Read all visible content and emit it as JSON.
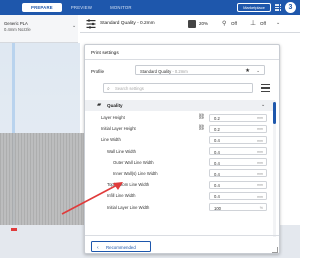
{
  "topbar": {
    "tabs": [
      {
        "label": "PREPARE",
        "active": true
      },
      {
        "label": "PREVIEW",
        "active": false
      },
      {
        "label": "MONITOR",
        "active": false
      }
    ],
    "marketplace_label": "Marketplace",
    "avatar_label": "3",
    "accent": "#1e57ac"
  },
  "material": {
    "name": "Generic PLA",
    "nozzle": "0.4mm Nozzle"
  },
  "settings_bar": {
    "quality": "Standard Quality - 0.2mm",
    "infill": "20%",
    "support": "Off",
    "adhesion": "Off"
  },
  "dialog": {
    "title": "Print settings",
    "profile_label": "Profile",
    "profile_value": "Standard Quality",
    "profile_suffix": " - 0.2mm",
    "search_placeholder": "Search settings",
    "section_label": "Quality",
    "recommended_label": "Recommended",
    "rows": [
      {
        "label": "Layer Height",
        "indent": 0,
        "linked": true,
        "value": "0.2",
        "unit": "mm"
      },
      {
        "label": "Initial Layer Height",
        "indent": 0,
        "linked": true,
        "value": "0.2",
        "unit": "mm"
      },
      {
        "label": "Line Width",
        "indent": 0,
        "linked": false,
        "value": "0.4",
        "unit": "mm"
      },
      {
        "label": "Wall Line Width",
        "indent": 1,
        "linked": false,
        "value": "0.4",
        "unit": "mm"
      },
      {
        "label": "Outer Wall Line Width",
        "indent": 2,
        "linked": false,
        "value": "0.4",
        "unit": "mm"
      },
      {
        "label": "Inner Wall(s) Line Width",
        "indent": 2,
        "linked": false,
        "value": "0.4",
        "unit": "mm"
      },
      {
        "label": "Top/Bottom Line Width",
        "indent": 1,
        "linked": false,
        "value": "0.4",
        "unit": "mm"
      },
      {
        "label": "Infill Line Width",
        "indent": 1,
        "linked": false,
        "value": "0.4",
        "unit": "mm"
      },
      {
        "label": "Initial Layer Line Width",
        "indent": 1,
        "linked": false,
        "value": "100",
        "unit": "%"
      }
    ]
  },
  "icons": {
    "settings_bar": "print-settings-icon",
    "infill": "infill-icon",
    "support": "support-icon",
    "adhesion": "adhesion-icon",
    "section": "quality-icon"
  },
  "annotation_color": "#e03b3b"
}
